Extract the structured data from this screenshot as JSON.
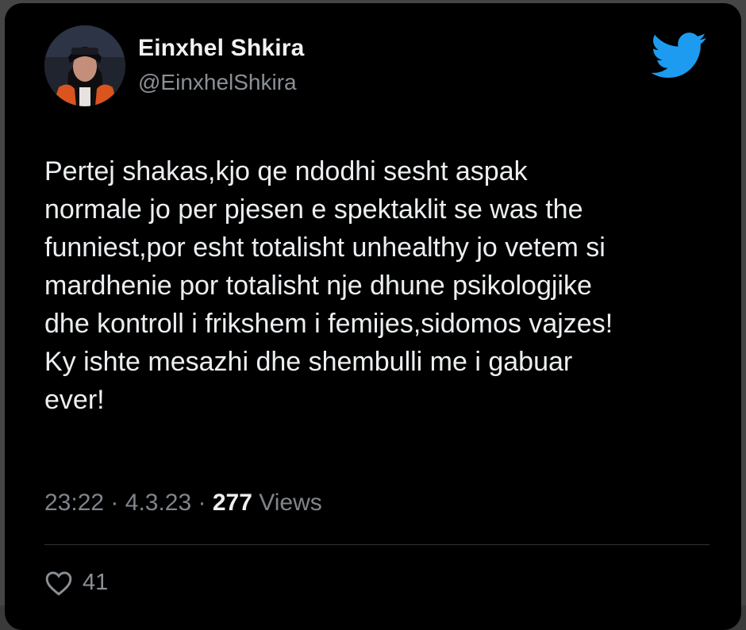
{
  "tweet": {
    "author_name": "Einxhel Shkira",
    "author_handle": "@EinxhelShkira",
    "text": "Pertej shakas,kjo qe ndodhi sesht aspak\nnormale jo per pjesen e spektaklit se was the\nfunniest,por esht totalisht unhealthy jo vetem si\nmardhenie por totalisht nje dhune psikologjike\ndhe kontroll i frikshem i femijes,sidomos vajzes!\nKy ishte mesazhi dhe shembulli me i gabuar\never!",
    "time": "23:22",
    "date": "4.3.23",
    "separator": "·",
    "views_count": "277",
    "views_label": "Views",
    "likes_count": "41"
  },
  "icons": {
    "brand": "twitter-bird-icon",
    "like": "heart-icon"
  },
  "colors": {
    "background": "#000000",
    "twitter_blue": "#1d9bf0",
    "secondary_text": "#8b9096"
  }
}
